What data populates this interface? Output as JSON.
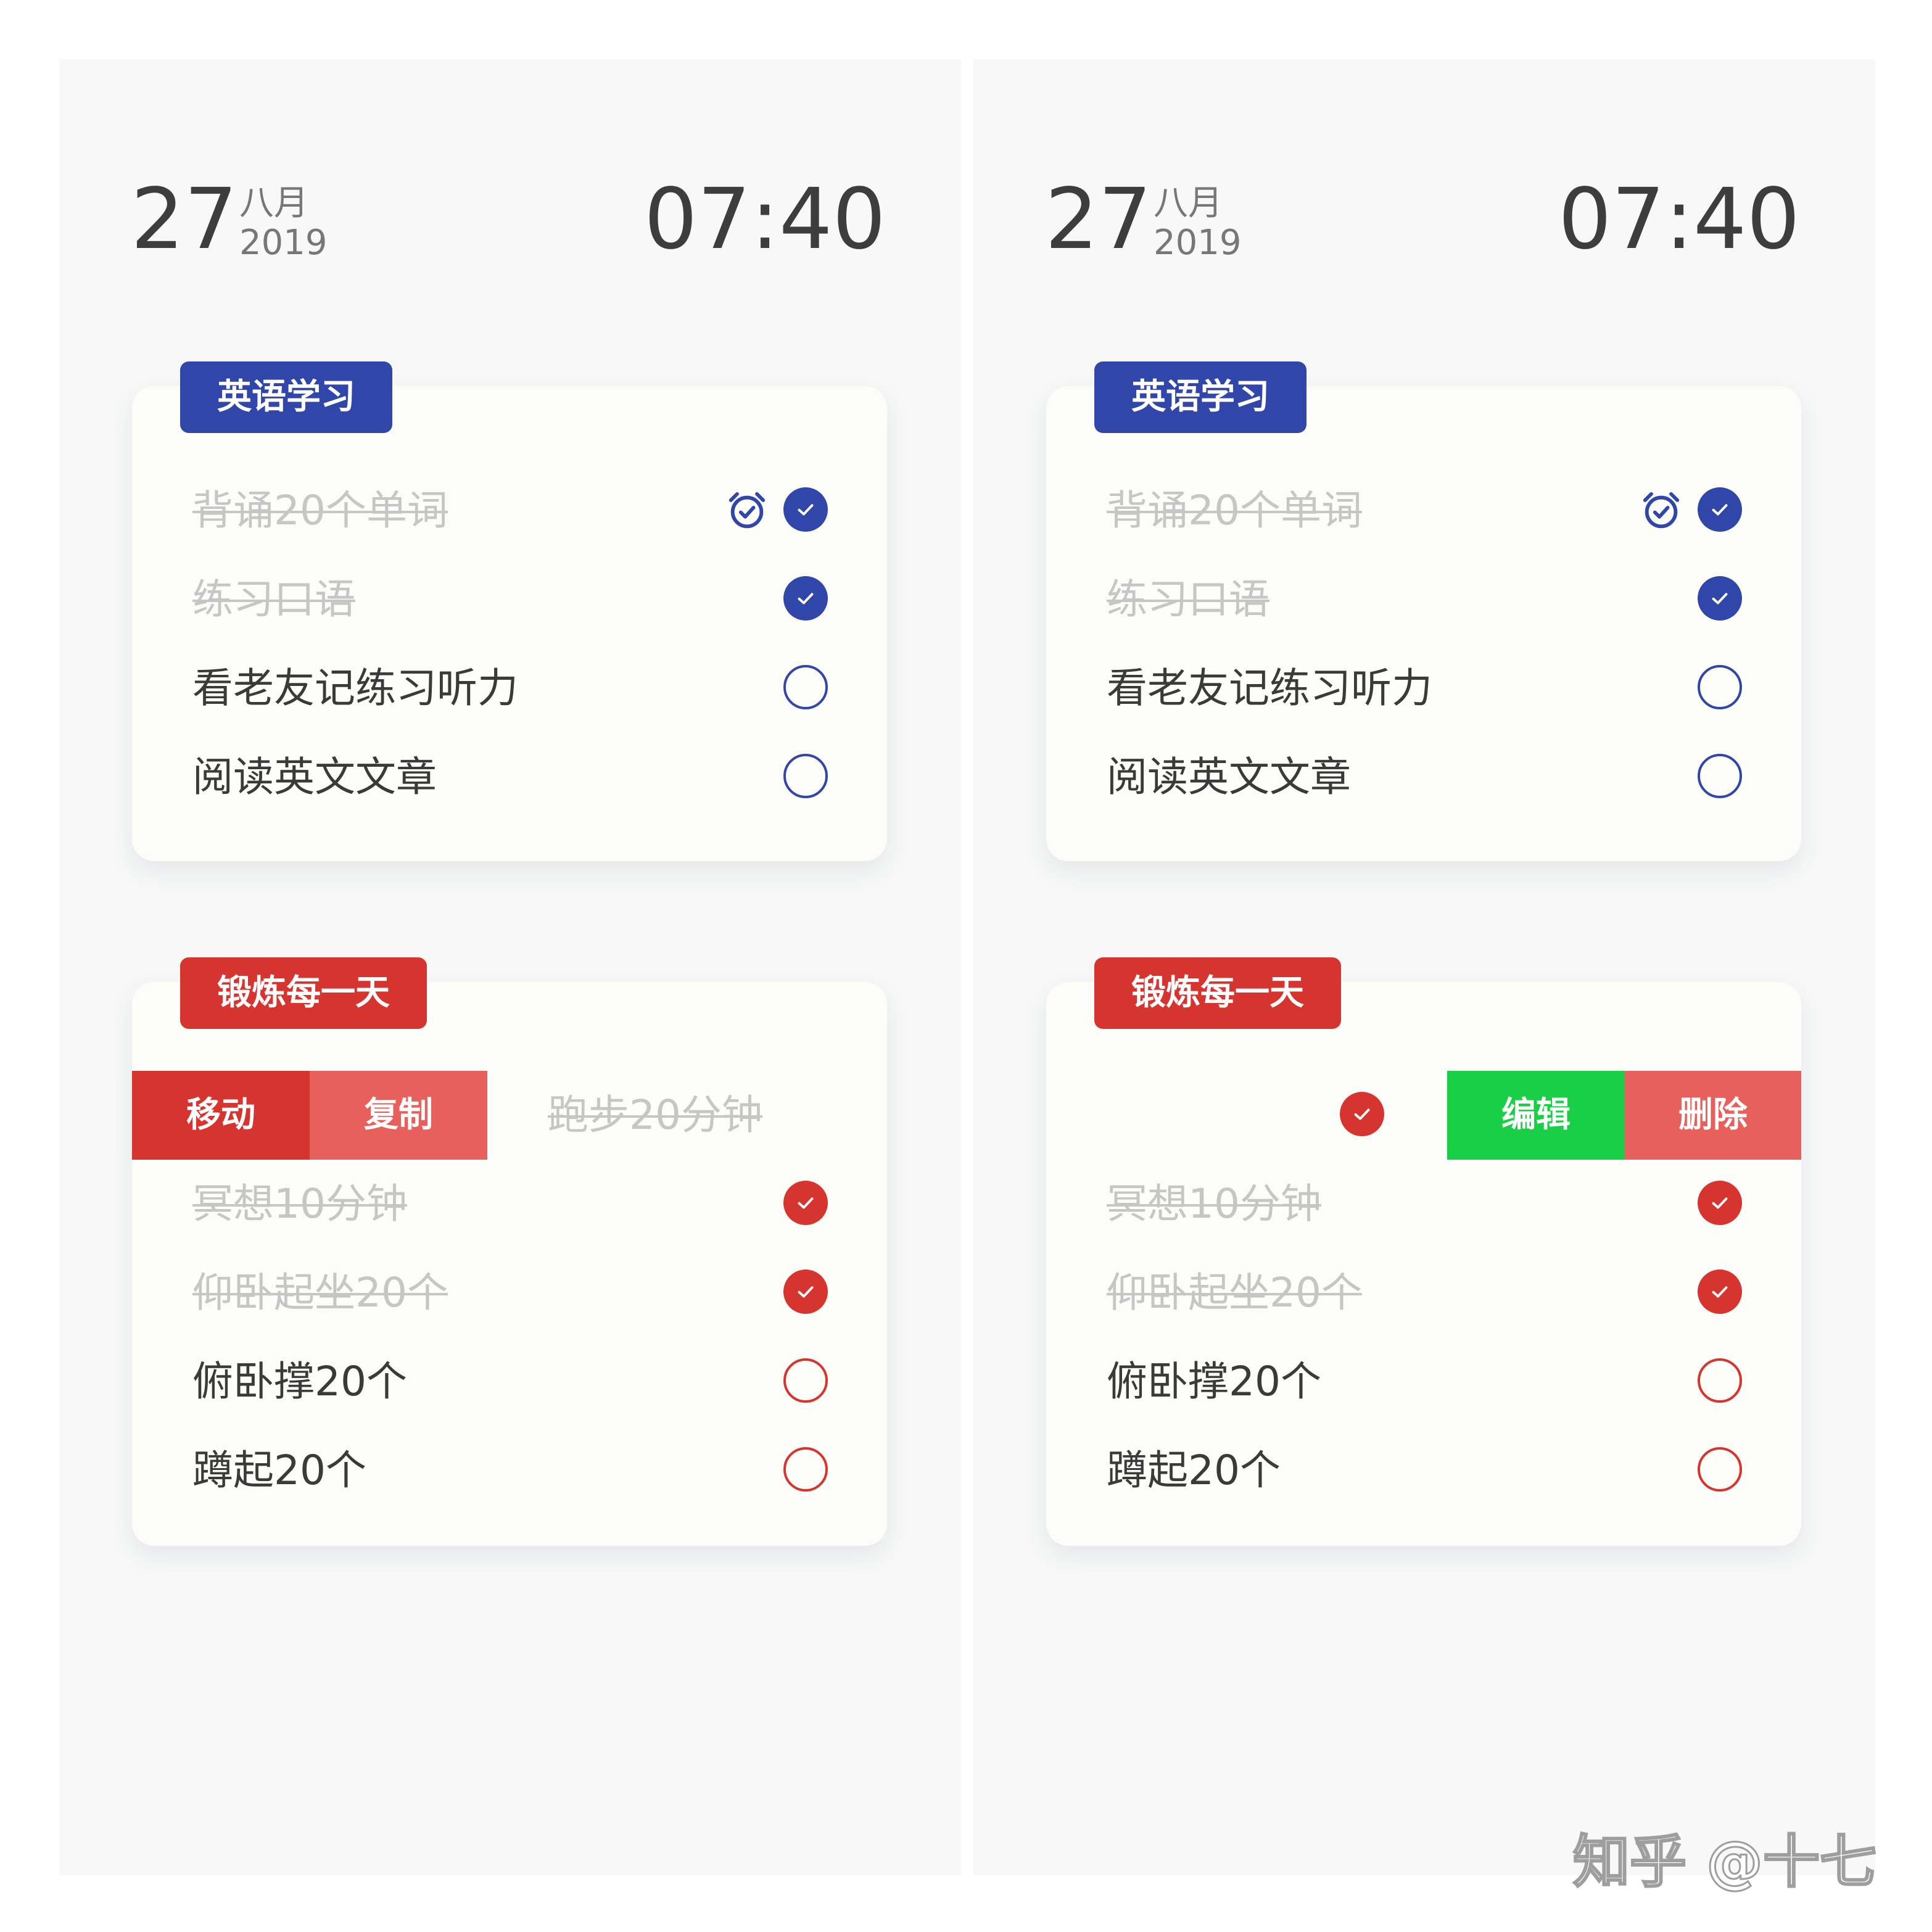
{
  "header": {
    "day": "27",
    "month": "八月",
    "year": "2019",
    "time": "07:40"
  },
  "groups": {
    "english": {
      "tag": "英语学习",
      "color": "#3046a8",
      "tasks": [
        {
          "label": "背诵20个单词",
          "done": true,
          "alarm": true
        },
        {
          "label": "练习口语",
          "done": true
        },
        {
          "label": "看老友记练习听力",
          "done": false
        },
        {
          "label": "阅读英文文章",
          "done": false
        }
      ]
    },
    "exercise": {
      "tag": "锻炼每一天",
      "color": "#d6352f",
      "tasks": [
        {
          "label": "跑步20分钟",
          "done": true
        },
        {
          "label": "冥想10分钟",
          "done": true
        },
        {
          "label": "仰卧起坐20个",
          "done": true
        },
        {
          "label": "俯卧撑20个",
          "done": false
        },
        {
          "label": "蹲起20个",
          "done": false
        }
      ]
    }
  },
  "swipe_actions": {
    "left": {
      "move": "移动",
      "copy": "复制"
    },
    "right": {
      "edit": "编辑",
      "delete": "删除"
    }
  },
  "colors": {
    "blue": "#3046a8",
    "red": "#d6352f",
    "light_red": "#e8605c",
    "green": "#19cf46"
  },
  "watermark": "知乎 @十七"
}
